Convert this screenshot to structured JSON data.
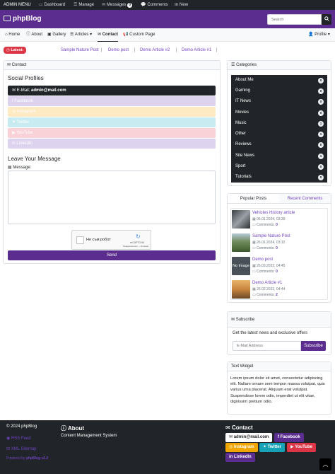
{
  "admin_bar": {
    "menu": "ADMIN MENU",
    "dashboard": "Dashboard",
    "manage": "Manage",
    "messages": "Messages",
    "messages_count": "0",
    "comments": "Comments",
    "new": "New"
  },
  "header": {
    "brand": "phpBlog",
    "search_placeholder": "Search"
  },
  "nav": {
    "home": "Home",
    "about": "About",
    "gallery": "Gallery",
    "articles": "Articles",
    "contact": "Contact",
    "custom_page": "Custom Page",
    "profile": "Profile"
  },
  "latest": {
    "label": "Latest:",
    "items": [
      "Sample Nature Post",
      "Demo post",
      "Demo Article #2",
      "Demo Article #1"
    ]
  },
  "contact": {
    "card_title": "Contact",
    "social_heading": "Social Profiles",
    "email_label": "E-Mail:",
    "email_value": "admin@mail.com",
    "socials": [
      "Facebook",
      "Instagram",
      "Twitter",
      "YouTube",
      "LinkedIn"
    ],
    "message_heading": "Leave Your Message",
    "message_label": "Message:",
    "captcha_text": "Не съм робот",
    "captcha_brand": "reCAPTCHA",
    "captcha_links": "Поверителност – Условия",
    "send": "Send"
  },
  "categories": {
    "title": "Categories",
    "items": [
      {
        "name": "About Me",
        "count": "0"
      },
      {
        "name": "Gaming",
        "count": "0"
      },
      {
        "name": "IT News",
        "count": "0"
      },
      {
        "name": "Movies",
        "count": "0"
      },
      {
        "name": "Music",
        "count": "1"
      },
      {
        "name": "Other",
        "count": "1"
      },
      {
        "name": "Reviews",
        "count": "0"
      },
      {
        "name": "Site News",
        "count": "1"
      },
      {
        "name": "Sport",
        "count": "0"
      },
      {
        "name": "Tutorials",
        "count": "0"
      }
    ]
  },
  "posts": {
    "tab_popular": "Popular Posts",
    "tab_recent": "Recent Comments",
    "comments_label": "Comments:",
    "no_image": "No Image",
    "items": [
      {
        "title": "Vehicles History article",
        "date": "06.01.2024, 03:39",
        "comments": "0"
      },
      {
        "title": "Sample Nature Post",
        "date": "26.01.2024, 03:12",
        "comments": "0"
      },
      {
        "title": "Demo post",
        "date": "26.03.2022, 04:45",
        "comments": "0"
      },
      {
        "title": "Demo Article #1",
        "date": "26.02.2022, 04:44",
        "comments": "2"
      }
    ]
  },
  "subscribe": {
    "title": "Subscribe",
    "text": "Get the latest news and exclusive offers",
    "placeholder": "E-Mail Address",
    "button": "Subscribe"
  },
  "text_widget": {
    "title": "Text Widget",
    "body": "Lorem ipsum dolor sit amet, consectetur adipiscing elit. Nullam ornare sem tempor massa volutpat, quis varius urna placerat. Aliquam erat volutpat. Suspendisse lorem odio, imperdiet ut elit vitae, dignissim pretium odio."
  },
  "footer": {
    "copyright": "© 2024 phpBlog",
    "rss": "RSS Feed",
    "sitemap": "XML Sitemap",
    "powered_prefix": "Powered by",
    "powered_name": "phpBlog v2.2",
    "about_title": "About",
    "about_text": "Content Management System",
    "contact_title": "Contact",
    "email": "admin@mail.com",
    "socials": [
      "Facebook",
      "Instagram",
      "Twitter",
      "YouTube",
      "LinkedIn"
    ]
  },
  "colors": {
    "brand": "#5b2d8e",
    "accent": "#6f42c1",
    "dark": "#212529",
    "danger": "#dc3545"
  }
}
